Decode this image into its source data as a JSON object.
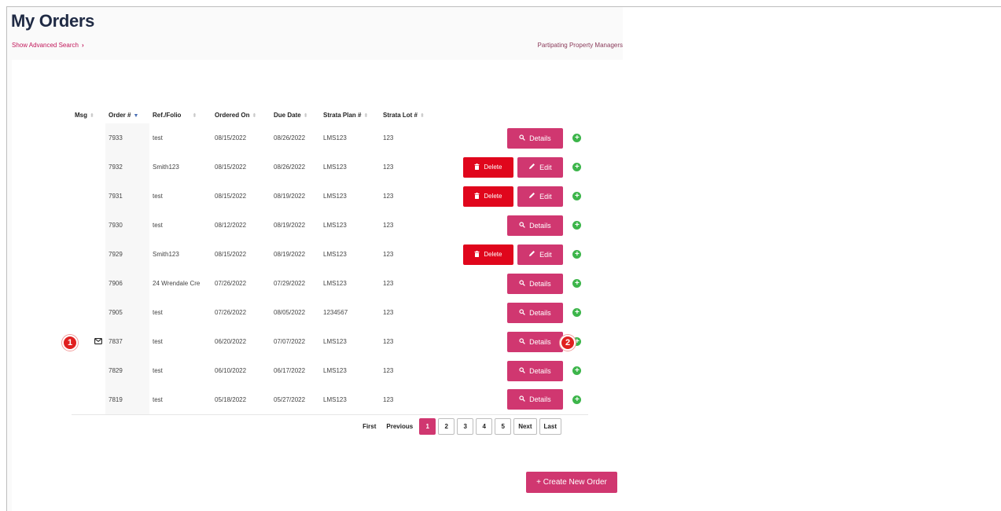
{
  "page": {
    "title": "My Orders"
  },
  "links": {
    "advanced_search": "Show Advanced Search",
    "advanced_search_chevron": "›",
    "property_managers": "Partipating Property Managers"
  },
  "table": {
    "columns": [
      "Msg",
      "Order #",
      "Ref./Folio",
      "Ordered On",
      "Due Date",
      "Strata Plan #",
      "Strata Lot #"
    ],
    "sorted_column": "Order #",
    "rows": [
      {
        "msg": false,
        "order": "7933",
        "ref": "test",
        "ordered_on": "08/15/2022",
        "due": "08/26/2022",
        "plan": "LMS123",
        "lot": "123",
        "actions": "details"
      },
      {
        "msg": false,
        "order": "7932",
        "ref": "Smith123",
        "ordered_on": "08/15/2022",
        "due": "08/26/2022",
        "plan": "LMS123",
        "lot": "123",
        "actions": "edit"
      },
      {
        "msg": false,
        "order": "7931",
        "ref": "test",
        "ordered_on": "08/15/2022",
        "due": "08/19/2022",
        "plan": "LMS123",
        "lot": "123",
        "actions": "edit"
      },
      {
        "msg": false,
        "order": "7930",
        "ref": "test",
        "ordered_on": "08/12/2022",
        "due": "08/19/2022",
        "plan": "LMS123",
        "lot": "123",
        "actions": "details"
      },
      {
        "msg": false,
        "order": "7929",
        "ref": "Smith123",
        "ordered_on": "08/15/2022",
        "due": "08/19/2022",
        "plan": "LMS123",
        "lot": "123",
        "actions": "edit"
      },
      {
        "msg": false,
        "order": "7906",
        "ref": "24 Wrendale Cre",
        "ordered_on": "07/26/2022",
        "due": "07/29/2022",
        "plan": "LMS123",
        "lot": "123",
        "actions": "details"
      },
      {
        "msg": false,
        "order": "7905",
        "ref": "test",
        "ordered_on": "07/26/2022",
        "due": "08/05/2022",
        "plan": "1234567",
        "lot": "123",
        "actions": "details"
      },
      {
        "msg": true,
        "order": "7837",
        "ref": "test",
        "ordered_on": "06/20/2022",
        "due": "07/07/2022",
        "plan": "LMS123",
        "lot": "123",
        "actions": "details"
      },
      {
        "msg": false,
        "order": "7829",
        "ref": "test",
        "ordered_on": "06/10/2022",
        "due": "06/17/2022",
        "plan": "LMS123",
        "lot": "123",
        "actions": "details"
      },
      {
        "msg": false,
        "order": "7819",
        "ref": "test",
        "ordered_on": "05/18/2022",
        "due": "05/27/2022",
        "plan": "LMS123",
        "lot": "123",
        "actions": "details"
      }
    ]
  },
  "buttons": {
    "details": "Details",
    "edit": "Edit",
    "delete": "Delete",
    "add": "+"
  },
  "pagination": {
    "first": "First",
    "previous": "Previous",
    "pages": [
      "1",
      "2",
      "3",
      "4",
      "5"
    ],
    "current": "1",
    "next": "Next",
    "last": "Last"
  },
  "create_button": "+ Create New Order",
  "callouts": {
    "one": "1",
    "two": "2"
  },
  "colors": {
    "accent": "#d03770",
    "delete": "#e0061c",
    "add": "#3cb54a",
    "callout": "#e02020",
    "title": "#1f2a44"
  }
}
